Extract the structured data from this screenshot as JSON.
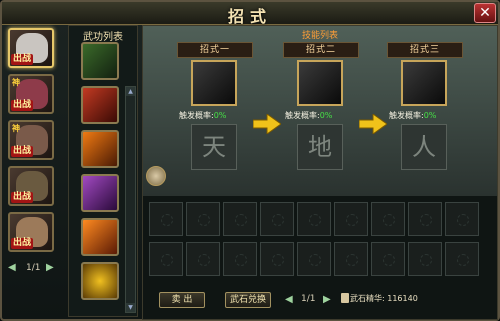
{
  "window": {
    "title": "招式",
    "close_glyph": "✕"
  },
  "roster": {
    "heroes": [
      {
        "id": "hero-1",
        "tag": "出战",
        "god": "",
        "face_color": "#c9c5c0"
      },
      {
        "id": "hero-2",
        "tag": "出战",
        "god": "神",
        "face_color": "#8e3b4a"
      },
      {
        "id": "hero-3",
        "tag": "出战",
        "god": "神",
        "face_color": "#7a5a4a"
      },
      {
        "id": "hero-4",
        "tag": "出战",
        "god": "",
        "face_color": "#6a5a40"
      },
      {
        "id": "hero-5",
        "tag": "出战",
        "god": "",
        "face_color": "#9c7a5a"
      }
    ],
    "page": "1/1",
    "prev_glyph": "◀",
    "next_glyph": "▶"
  },
  "skill_list": {
    "title": "武功列表",
    "icons": [
      {
        "name": "skill-icon-1",
        "color": "#3b6a2a"
      },
      {
        "name": "skill-icon-2",
        "color": "#8a2a1a"
      },
      {
        "name": "skill-icon-3",
        "color": "#c25a12"
      },
      {
        "name": "skill-icon-4",
        "color": "#6a2a7a"
      },
      {
        "name": "skill-icon-5",
        "color": "#c0561a"
      },
      {
        "name": "skill-icon-6",
        "color": "#8a6a12"
      }
    ],
    "scroll_up": "▲",
    "scroll_down": "▼"
  },
  "moves_panel": {
    "label": "技能列表",
    "moves": [
      {
        "name": "招式一",
        "rate_label": "触发概率:",
        "rate": "0%",
        "slot": "天"
      },
      {
        "name": "招式二",
        "rate_label": "触发概率:",
        "rate": "0%",
        "slot": "地"
      },
      {
        "name": "招式三",
        "rate_label": "触发概率:",
        "rate": "0%",
        "slot": "人"
      }
    ],
    "arrow_color": "#f0c21a"
  },
  "inventory": {
    "page": "1/1",
    "prev_glyph": "◀",
    "next_glyph": "▶"
  },
  "buttons": {
    "sell": "卖 出",
    "exchange": "武石兑换"
  },
  "ore": {
    "label": "武石精华:",
    "amount": "116140"
  }
}
